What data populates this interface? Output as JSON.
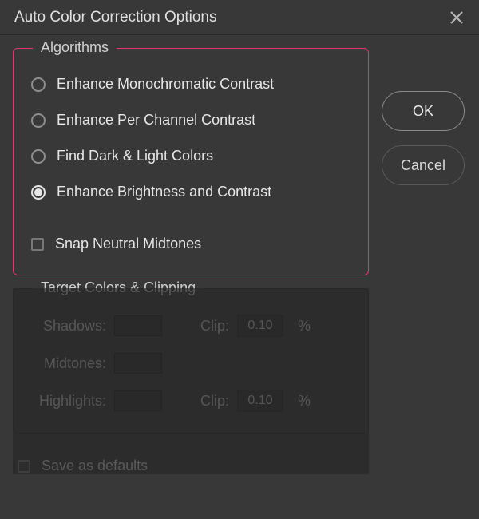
{
  "dialog": {
    "title": "Auto Color Correction Options"
  },
  "fieldsets": {
    "algorithms": {
      "legend": "Algorithms",
      "options": [
        "Enhance Monochromatic Contrast",
        "Enhance Per Channel Contrast",
        "Find Dark & Light Colors",
        "Enhance Brightness and Contrast"
      ],
      "selected_index": 3,
      "snap_label": "Snap Neutral Midtones",
      "snap_checked": false
    },
    "target": {
      "legend": "Target Colors & Clipping",
      "shadows_label": "Shadows:",
      "midtones_label": "Midtones:",
      "highlights_label": "Highlights:",
      "clip_label": "Clip:",
      "shadows_clip": "0.10",
      "highlights_clip": "0.10",
      "percent": "%"
    }
  },
  "save_defaults": {
    "label": "Save as defaults",
    "checked": false
  },
  "buttons": {
    "ok": "OK",
    "cancel": "Cancel"
  }
}
